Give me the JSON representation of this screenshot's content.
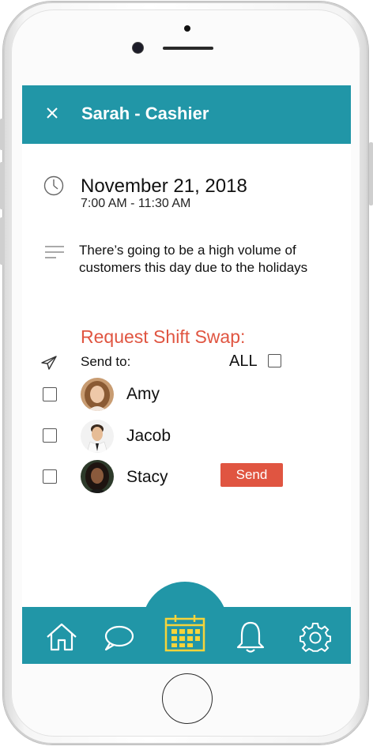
{
  "header": {
    "title": "Sarah - Cashier",
    "close_icon": "close-icon"
  },
  "event": {
    "date": "November 21, 2018",
    "time": "7:00 AM - 11:30 AM",
    "note": "There’s going to be a high volume of customers this day due to the holidays"
  },
  "swap": {
    "title": "Request Shift Swap:",
    "send_to_label": "Send to:",
    "all_label": "ALL",
    "send_button": "Send",
    "people": [
      {
        "name": "Amy",
        "checked": false
      },
      {
        "name": "Jacob",
        "checked": false
      },
      {
        "name": "Stacy",
        "checked": false
      }
    ]
  },
  "nav": {
    "items": [
      "home-icon",
      "chat-icon",
      "calendar-icon",
      "bell-icon",
      "gear-icon"
    ],
    "active": "calendar-icon"
  },
  "colors": {
    "primary": "#2196a7",
    "accent": "#e05541",
    "calendar_active": "#f6d43a"
  }
}
